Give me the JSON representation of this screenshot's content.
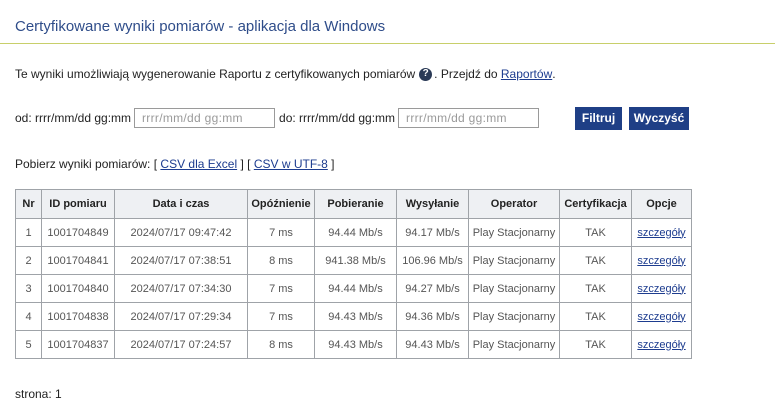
{
  "header": {
    "title": "Certyfikowane wyniki pomiarów - aplikacja dla Windows"
  },
  "info": {
    "text_before": "Te wyniki umożliwiają wygenerowanie Raportu z certyfikowanych pomiarów",
    "help_icon": "question-circle-icon",
    "text_mid": ". Przejdź do ",
    "reports_link": "Raportów",
    "text_after": "."
  },
  "filter": {
    "from_label": "od: rrrr/mm/dd gg:mm",
    "from_placeholder": "rrrr/mm/dd gg:mm",
    "to_label": "do: rrrr/mm/dd gg:mm",
    "to_placeholder": "rrrr/mm/dd gg:mm",
    "filter_button": "Filtruj",
    "clear_button": "Wyczyść",
    "button_color": "#1f3f86"
  },
  "download": {
    "label": "Pobierz wyniki pomiarów: [",
    "csv_excel": "CSV dla Excel",
    "sep": "] [",
    "csv_utf8": "CSV w UTF-8",
    "end": "]"
  },
  "table": {
    "headers": [
      "Nr",
      "ID pomiaru",
      "Data i czas",
      "Opóźnienie",
      "Pobieranie",
      "Wysyłanie",
      "Operator",
      "Certyfikacja",
      "Opcje"
    ],
    "rows": [
      [
        "1",
        "1001704849",
        "2024/07/17 09:47:42",
        "7 ms",
        "94.44 Mb/s",
        "94.17 Mb/s",
        "Play Stacjonarny",
        "TAK",
        "szczegóły"
      ],
      [
        "2",
        "1001704841",
        "2024/07/17 07:38:51",
        "8 ms",
        "941.38 Mb/s",
        "106.96 Mb/s",
        "Play Stacjonarny",
        "TAK",
        "szczegóły"
      ],
      [
        "3",
        "1001704840",
        "2024/07/17 07:34:30",
        "7 ms",
        "94.44 Mb/s",
        "94.27 Mb/s",
        "Play Stacjonarny",
        "TAK",
        "szczegóły"
      ],
      [
        "4",
        "1001704838",
        "2024/07/17 07:29:34",
        "7 ms",
        "94.43 Mb/s",
        "94.36 Mb/s",
        "Play Stacjonarny",
        "TAK",
        "szczegóły"
      ],
      [
        "5",
        "1001704837",
        "2024/07/17 07:24:57",
        "8 ms",
        "94.43 Mb/s",
        "94.43 Mb/s",
        "Play Stacjonarny",
        "TAK",
        "szczegóły"
      ]
    ]
  },
  "pagination": {
    "label": "strona: 1"
  }
}
